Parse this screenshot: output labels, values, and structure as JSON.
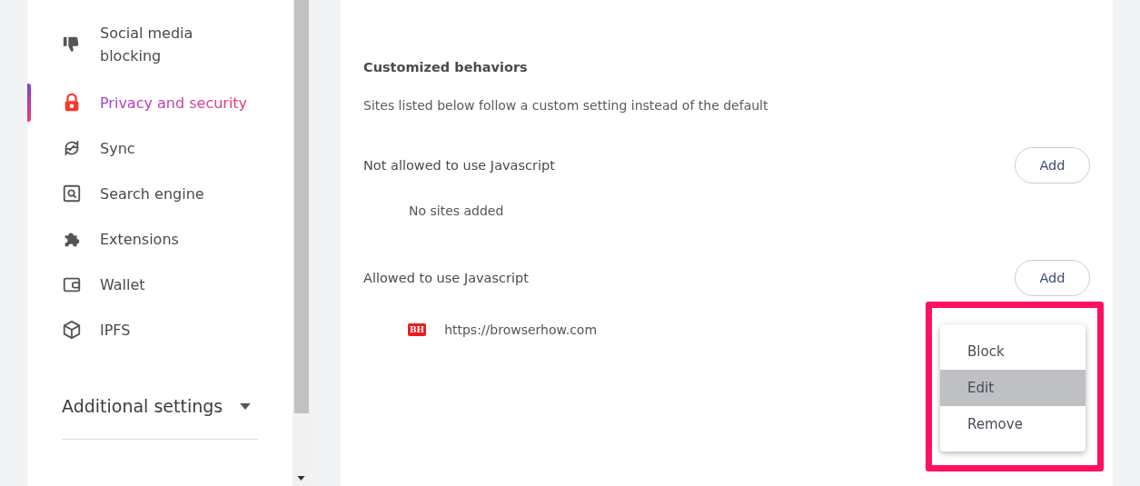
{
  "sidebar": {
    "items": [
      {
        "label": "Social media blocking",
        "kind": "thumbs-down",
        "selected": false
      },
      {
        "label": "Privacy and security",
        "kind": "lock",
        "selected": true
      },
      {
        "label": "Sync",
        "kind": "sync",
        "selected": false
      },
      {
        "label": "Search engine",
        "kind": "search",
        "selected": false
      },
      {
        "label": "Extensions",
        "kind": "puzzle",
        "selected": false
      },
      {
        "label": "Wallet",
        "kind": "wallet",
        "selected": false
      },
      {
        "label": "IPFS",
        "kind": "cube",
        "selected": false
      }
    ],
    "additional_settings": {
      "label": "Additional settings",
      "expanded": false
    }
  },
  "content": {
    "title": "Customized behaviors",
    "description": "Sites listed below follow a custom setting instead of the default",
    "sections": [
      {
        "label": "Not allowed to use Javascript",
        "button": "Add",
        "empty_text": "No sites added"
      },
      {
        "label": "Allowed to use Javascript",
        "button": "Add",
        "sites": [
          {
            "favicon_text": "BH",
            "url": "https://browserhow.com"
          }
        ]
      }
    ]
  },
  "context_menu": {
    "items": [
      {
        "label": "Block",
        "selected": false
      },
      {
        "label": "Edit",
        "selected": true
      },
      {
        "label": "Remove",
        "selected": false
      }
    ]
  }
}
